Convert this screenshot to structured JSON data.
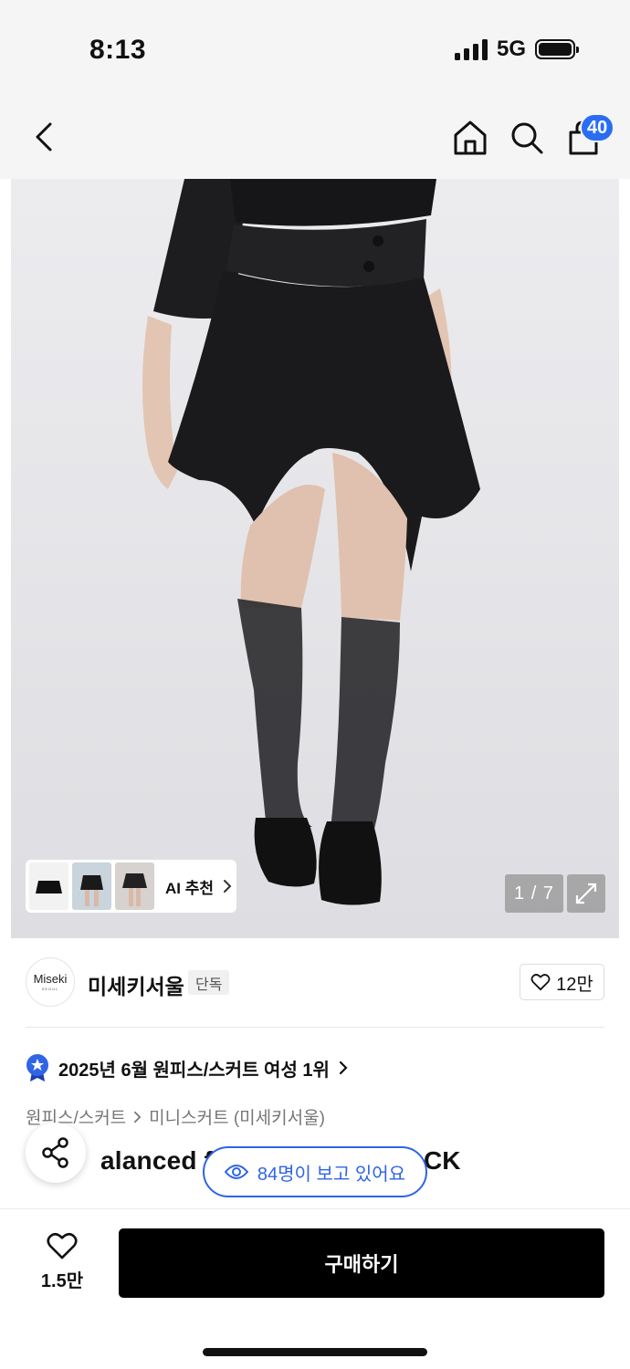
{
  "status_bar": {
    "time": "8:13",
    "network": "5G"
  },
  "header": {
    "cart_count": "40"
  },
  "gallery": {
    "ai_recommend_label": "AI 추천",
    "page_indicator": "1 / 7"
  },
  "brand": {
    "logo_text": "Miseki",
    "logo_subtext": "SEOUL",
    "name": "미세키서울",
    "badge": "단독",
    "like_count": "12만"
  },
  "ranking": {
    "text": "2025년 6월 원피스/스커트 여성 1위"
  },
  "breadcrumb": {
    "category": "원피스/스커트",
    "subcategory": "미니스커트 (미세키서울)"
  },
  "product": {
    "title_visible_start": "alanced fl",
    "title_visible_end": "CK"
  },
  "viewers": {
    "text": "84명이 보고 있어요"
  },
  "bottom": {
    "wish_count": "1.5만",
    "buy_label": "구매하기"
  },
  "colors": {
    "accent_blue": "#2f65e5",
    "badge_blue": "#2a6df4",
    "buy_black": "#000000"
  }
}
